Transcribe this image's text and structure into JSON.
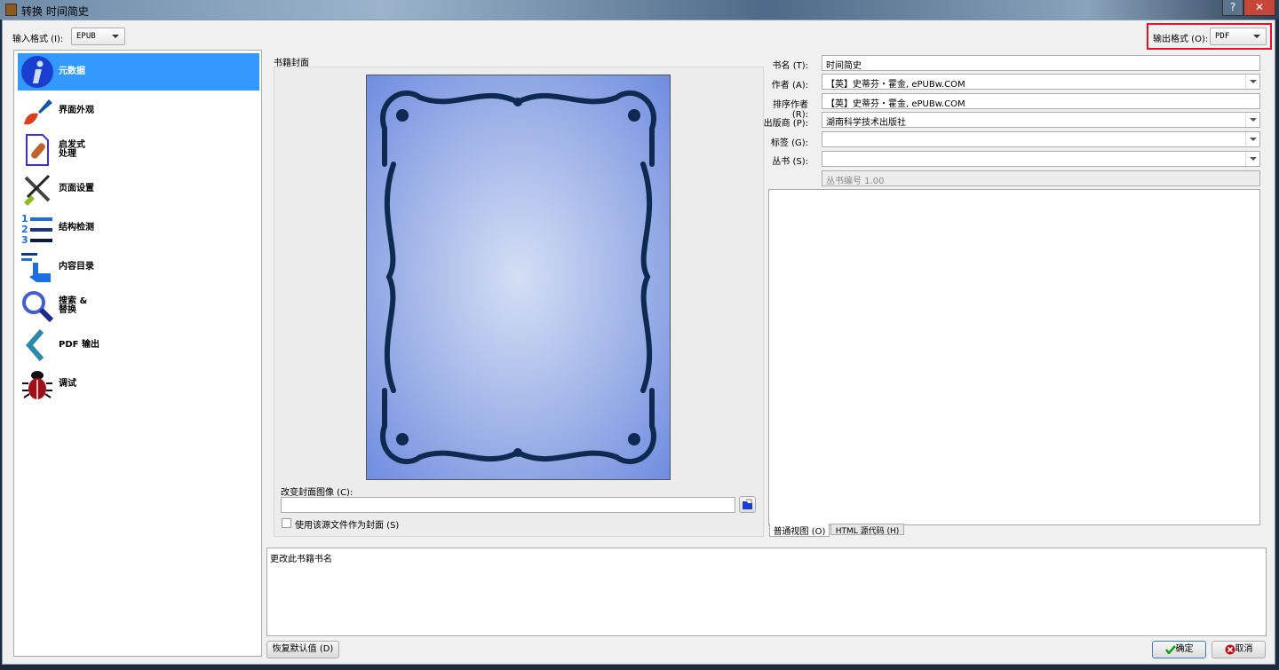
{
  "window": {
    "title": "转换 时间简史",
    "help": "?",
    "close": "✕"
  },
  "input_format": {
    "label": "输入格式 (I):",
    "value": "EPUB"
  },
  "output_format": {
    "label": "输出格式 (O):",
    "value": "PDF",
    "highlight_color": "#e81123"
  },
  "sidebar": {
    "items": [
      {
        "label": "元数据",
        "icon": "info-icon",
        "selected": true
      },
      {
        "label": "界面外观",
        "icon": "paintbrush-icon"
      },
      {
        "label": "启发式\n处理",
        "icon": "document-bandage-icon"
      },
      {
        "label": "页面设置",
        "icon": "tools-icon"
      },
      {
        "label": "结构检测",
        "icon": "numbered-list-icon"
      },
      {
        "label": "内容目录",
        "icon": "toc-hand-icon"
      },
      {
        "label": "搜索 &\n替换",
        "icon": "magnifier-icon"
      },
      {
        "label": "PDF 输出",
        "icon": "chevron-left-icon"
      },
      {
        "label": "调试",
        "icon": "bug-icon"
      }
    ]
  },
  "cover": {
    "group_label": "书籍封面",
    "change_label": "改变封面图像 (C):",
    "path_value": "",
    "use_source_label": "使用该源文件作为封面 (S)",
    "use_source_checked": false
  },
  "metadata": {
    "title": {
      "label": "书名 (T):",
      "value": "时间简史"
    },
    "author": {
      "label": "作者 (A):",
      "value": "【英】史蒂芬・霍金, ePUBw.COM"
    },
    "author_sort": {
      "label": "排序作者 (R):",
      "value": "【英】史蒂芬・霍金, ePUBw.COM"
    },
    "publisher": {
      "label": "出版商 (P):",
      "value": "湖南科学技术出版社"
    },
    "tags": {
      "label": "标签 (G):",
      "value": ""
    },
    "series": {
      "label": "丛书 (S):",
      "value": ""
    },
    "series_index": {
      "value": "丛书编号 1.00"
    },
    "tabs": [
      {
        "label": "普通视图 (O)",
        "active": true
      },
      {
        "label": "HTML 源代码 (H)"
      }
    ]
  },
  "help_text": "更改此书籍书名",
  "buttons": {
    "restore": "恢复默认值 (D)",
    "ok": "确定",
    "cancel": "取消"
  }
}
